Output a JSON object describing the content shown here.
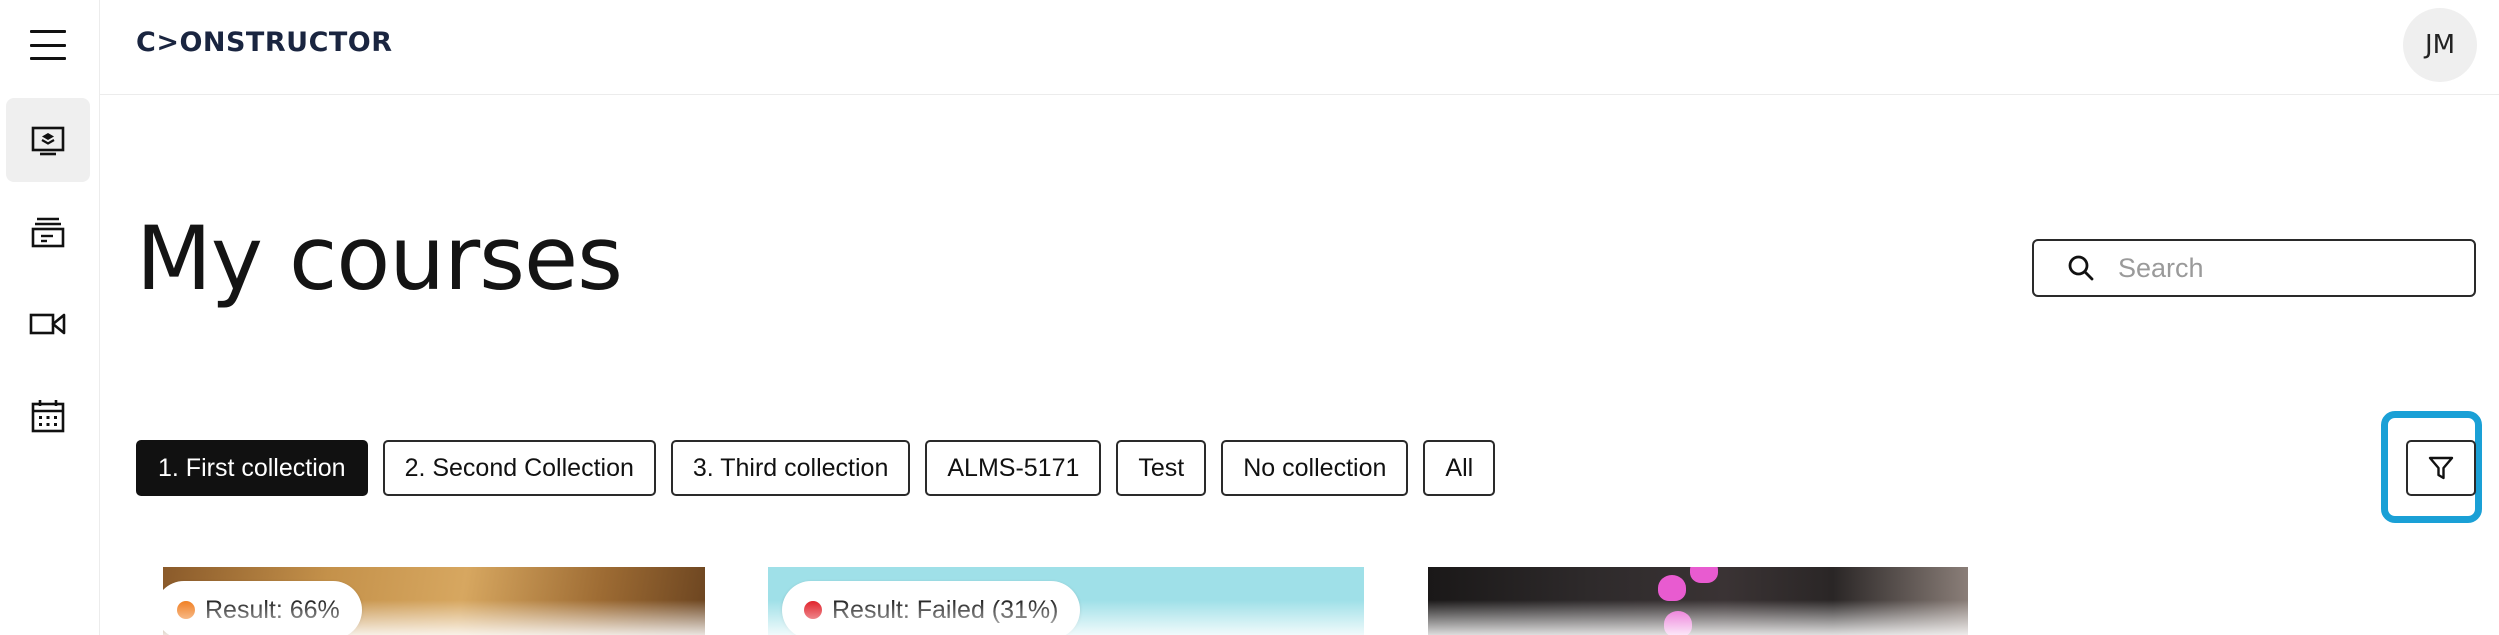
{
  "header": {
    "logo": "C>ONSTRUCTOR",
    "avatar_initials": "JM"
  },
  "sidebar": {
    "menu_icon": "hamburger-menu-icon",
    "items": [
      {
        "name": "courses",
        "icon": "course-layers-icon",
        "active": true
      },
      {
        "name": "collections",
        "icon": "archive-box-icon",
        "active": false
      },
      {
        "name": "video",
        "icon": "video-camera-icon",
        "active": false
      },
      {
        "name": "calendar",
        "icon": "calendar-icon",
        "active": false
      }
    ]
  },
  "main": {
    "title": "My courses",
    "search": {
      "placeholder": "Search",
      "value": ""
    },
    "collections": [
      {
        "label": "1. First collection",
        "active": true
      },
      {
        "label": "2. Second Collection",
        "active": false
      },
      {
        "label": "3. Third collection",
        "active": false
      },
      {
        "label": "ALMS-5171",
        "active": false
      },
      {
        "label": "Test",
        "active": false
      },
      {
        "label": "No collection",
        "active": false
      },
      {
        "label": "All",
        "active": false
      }
    ],
    "filter_icon": "filter-funnel-icon",
    "cards": [
      {
        "badge": "Result: 66%",
        "status_color": "#f07d1f"
      },
      {
        "badge": "Result: Failed (31%)",
        "status_color": "#e01e27"
      },
      {
        "badge": "",
        "status_color": ""
      }
    ]
  },
  "colors": {
    "accent_highlight": "#1aa0d6",
    "active_chip": "#111111"
  }
}
